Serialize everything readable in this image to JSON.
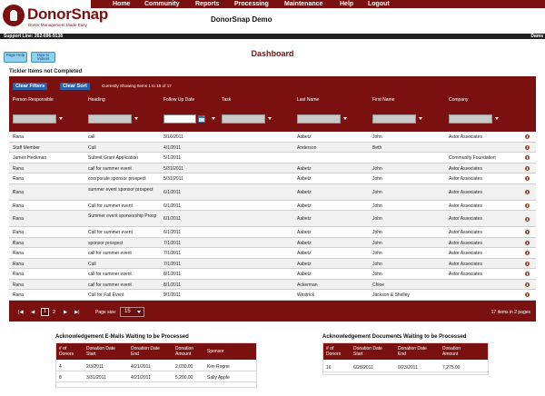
{
  "app": {
    "logo_name": "DonorSnap",
    "logo_tagline": "Donor Management Made Easy",
    "org_title": "DonorSnap Demo",
    "support": "Support Line: 262-696-9138",
    "user": "Dams"
  },
  "nav": [
    "Home",
    "Community",
    "Reports",
    "Processing",
    "Maintenance",
    "Help",
    "Logout"
  ],
  "page_title": "Dashboard",
  "help_buttons": [
    "Page Help",
    "How to Videos"
  ],
  "tickler": {
    "section_label": "Tickler Items not Completed",
    "clear_filters": "Clear Filters",
    "clear_sort": "Clear Sort",
    "showing": "Currently Showing Items 1 to 15 of 17",
    "columns": [
      "Person Responsible",
      "Heading",
      "Follow Up Date",
      "Task",
      "Last Name",
      "First Name",
      "Company"
    ],
    "rows": [
      {
        "person": "Rana",
        "heading": "call",
        "date": "3/16/2011",
        "task": "",
        "last": "Aabetz",
        "first": "John",
        "company": "Astor Associates"
      },
      {
        "person": "Staff Member",
        "heading": "Call",
        "date": "4/1/2011",
        "task": "",
        "last": "Anderson",
        "first": "Beth",
        "company": ""
      },
      {
        "person": "James Heckman",
        "heading": "Submit Grant Application",
        "date": "5/1/2011",
        "task": "",
        "last": "",
        "first": "",
        "company": "Community Foundation"
      },
      {
        "person": "Rana",
        "heading": "call for summer event",
        "date": "5/31/2011",
        "task": "",
        "last": "Aabetz",
        "first": "John",
        "company": "Astor Associates"
      },
      {
        "person": "Rana",
        "heading": "coorporate sponsor prospect",
        "date": "5/31/2011",
        "task": "",
        "last": "Aabetz",
        "first": "John",
        "company": "Astor Associates"
      },
      {
        "person": "Rana",
        "heading": "summer event sponsor prospect",
        "date": "6/1/2011",
        "task": "",
        "last": "Aabetz",
        "first": "John",
        "company": "Astor Associates"
      },
      {
        "person": "Rana",
        "heading": "Call for summer event",
        "date": "6/1/2011",
        "task": "",
        "last": "Aabetz",
        "first": "John",
        "company": "Astor Associates"
      },
      {
        "person": "Rana",
        "heading": "Summer event sponsorship Prosp",
        "date": "6/1/2011",
        "task": "",
        "last": "Aabetz",
        "first": "John",
        "company": "Astor Associates"
      },
      {
        "person": "Rana",
        "heading": "Call for summer event",
        "date": "6/1/2011",
        "task": "",
        "last": "Aabetz",
        "first": "John",
        "company": "Astor Associates"
      },
      {
        "person": "Rana",
        "heading": "sponsor prospect",
        "date": "7/1/2011",
        "task": "",
        "last": "Aabetz",
        "first": "John",
        "company": "Astor Associates"
      },
      {
        "person": "Rana",
        "heading": "call for summer event",
        "date": "7/1/2011",
        "task": "",
        "last": "Aabetz",
        "first": "John",
        "company": "Astor Associates"
      },
      {
        "person": "Rana",
        "heading": "Call",
        "date": "7/1/2011",
        "task": "",
        "last": "Aabetz",
        "first": "John",
        "company": "Astor Associates"
      },
      {
        "person": "Rana",
        "heading": "call for summer event",
        "date": "8/1/2011",
        "task": "",
        "last": "Aabetz",
        "first": "John",
        "company": "Astor Associates"
      },
      {
        "person": "Rana",
        "heading": "call for summer event",
        "date": "8/1/2011",
        "task": "",
        "last": "Ackerman",
        "first": "Chloe",
        "company": ""
      },
      {
        "person": "Rana",
        "heading": "Call for Fall Event",
        "date": "9/1/2011",
        "task": "",
        "last": "Westrick",
        "first": "Jackson & Shelley",
        "company": ""
      }
    ],
    "pager": {
      "first": "|◀",
      "prev": "◀",
      "current_page": "1",
      "next_page": "2",
      "next": "▶",
      "last": "▶|",
      "page_size_label": "Page size:",
      "page_size": "15",
      "items_info": "17 items in 2 pages"
    }
  },
  "ack_emails": {
    "title": "Acknowledgement E-Mails Waiting to be Processed",
    "columns": [
      "# of Donors",
      "Donation Date Start",
      "Donation Date End",
      "Donation Amount",
      "Sponsor"
    ],
    "rows": [
      [
        "4",
        "2/3/2011",
        "4/21/2011",
        "2,030.00",
        "Kim Rogne"
      ],
      [
        "8",
        "3/31/2011",
        "4/21/2011",
        "5,200.00",
        "Sally Apple"
      ]
    ]
  },
  "ack_docs": {
    "title": "Acknowledgement Documents Waiting to be Processed",
    "columns": [
      "# of Donors",
      "Donation Date Start",
      "Donation Date End",
      "Donation Amount"
    ],
    "rows": [
      [
        "16",
        "6/28/2011",
        "9/23/2011",
        "7,275.00"
      ]
    ]
  },
  "colors": {
    "brand": "#7a1010",
    "button_blue": "#2d5fa5",
    "help_button": "#8fd0ef"
  }
}
